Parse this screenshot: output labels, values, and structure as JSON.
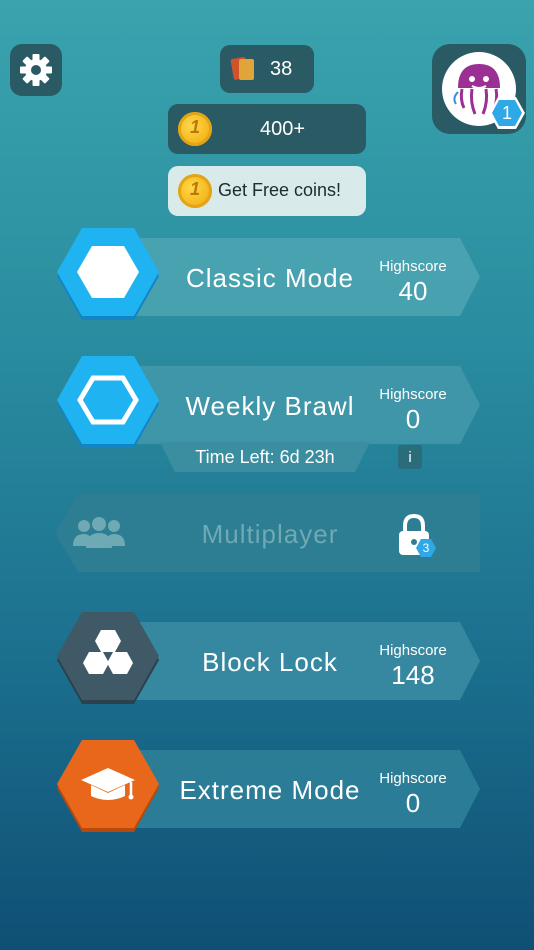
{
  "header": {
    "cards_count": "38",
    "coins_amount": "400+",
    "free_coins_label": "Get Free coins!",
    "coin_glyph": "1",
    "player_level": "1"
  },
  "modes": [
    {
      "title": "Classic Mode",
      "highscore_label": "Highscore",
      "highscore": "40",
      "color": "#1fb4f2"
    },
    {
      "title": "Weekly Brawl",
      "highscore_label": "Highscore",
      "highscore": "0",
      "time_left": "Time Left: 6d 23h",
      "info_label": "i",
      "color": "#1fb4f2"
    },
    {
      "title": "Multiplayer",
      "locked": true,
      "unlock_level": "3"
    },
    {
      "title": "Block Lock",
      "highscore_label": "Highscore",
      "highscore": "148",
      "color": "#3f5a66"
    },
    {
      "title": "Extreme Mode",
      "highscore_label": "Highscore",
      "highscore": "0",
      "color": "#e8671a"
    }
  ],
  "icons": {
    "settings": "gear-icon",
    "cards": "cards-icon",
    "coin": "coin-icon",
    "avatar": "jellyfish-avatar-icon",
    "multiplayer": "people-icon",
    "lock": "lock-icon",
    "graduation": "graduation-cap-icon"
  }
}
